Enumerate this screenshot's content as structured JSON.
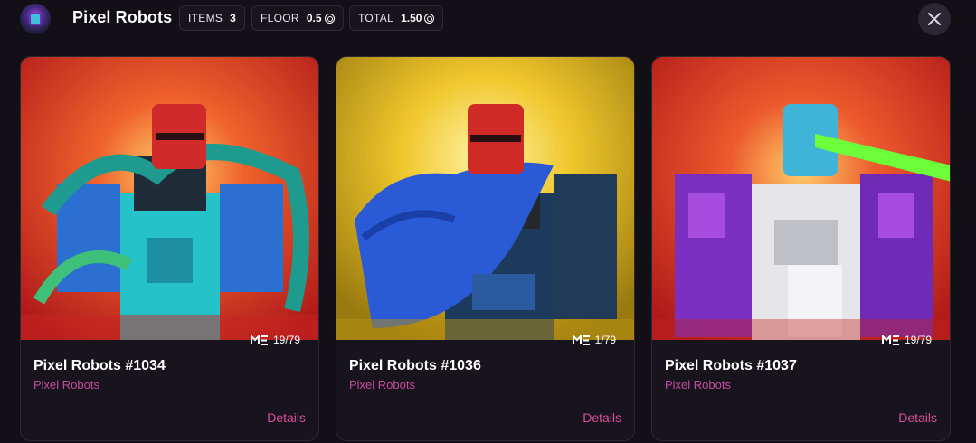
{
  "header": {
    "title": "Pixel Robots",
    "stats": [
      {
        "label": "ITEMS",
        "value": "3",
        "icon": null
      },
      {
        "label": "FLOOR",
        "value": "0.5",
        "icon": "sol-icon"
      },
      {
        "label": "TOTAL",
        "value": "1.50",
        "icon": "sol-icon"
      }
    ]
  },
  "cards": [
    {
      "name": "Pixel Robots #1034",
      "collection": "Pixel Robots",
      "rank": "19/79",
      "details_label": "Details",
      "background": "#d9402c"
    },
    {
      "name": "Pixel Robots #1036",
      "collection": "Pixel Robots",
      "rank": "1/79",
      "details_label": "Details",
      "background": "#e6c02a"
    },
    {
      "name": "Pixel Robots #1037",
      "collection": "Pixel Robots",
      "rank": "19/79",
      "details_label": "Details",
      "background": "#d63a2c"
    }
  ],
  "colors": {
    "page_bg": "#120f17",
    "accent": "#d94f9d",
    "card_bg": "#17141d"
  }
}
